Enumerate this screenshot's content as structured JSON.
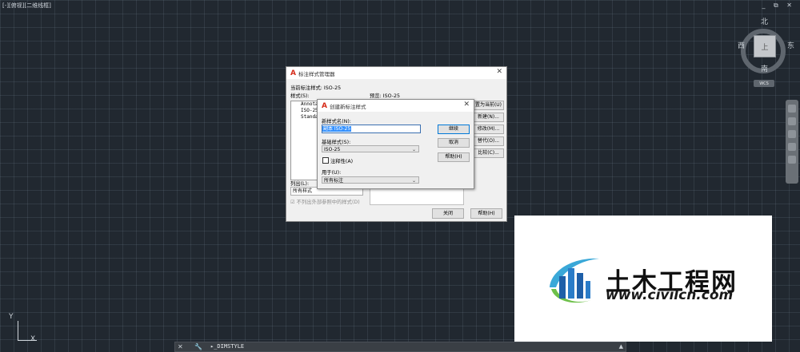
{
  "viewport_label": "[-][俯视][二维线框]",
  "window_controls": "_ ⧉ ✕",
  "viewcube": {
    "north": "北",
    "south": "南",
    "west": "西",
    "east": "东",
    "face": "上",
    "wcs": "WCS"
  },
  "ucs": {
    "x_label": "X",
    "y_label": "Y"
  },
  "command_line": {
    "icons": "✕ 🔧",
    "text": "▸_DIMSTYLE",
    "arrow": "▲"
  },
  "dim_style_manager": {
    "title": "标注样式管理器",
    "current_style": "当前标注样式: ISO-25",
    "styles_label": "样式(S):",
    "styles": [
      "Annotative",
      "ISO-25",
      "Standard"
    ],
    "preview_label": "预览: ISO-25",
    "side_buttons": [
      "置为当前(U)",
      "新建(N)...",
      "修改(M)...",
      "替代(O)...",
      "比较(C)..."
    ],
    "list_label": "列出(L):",
    "list_value": "所有样式",
    "exclude_xref": "不列出外部参照中的样式(D)",
    "close_button": "关闭",
    "help_button": "帮助(H)"
  },
  "new_dim_style": {
    "title": "创建新标注样式",
    "name_label": "新样式名(N):",
    "name_value": "副本 ISO-25",
    "base_label": "基础样式(S):",
    "base_value": "ISO-25",
    "annotative_label": "注释性(A)",
    "use_for_label": "用于(U):",
    "use_for_value": "所有标注",
    "continue_button": "继续",
    "cancel_button": "取消",
    "help_button": "帮助(H)"
  },
  "watermark": {
    "name": "土木工程网",
    "url": "www.civilcn.com"
  },
  "colors": {
    "canvas_bg": "#212830",
    "dialog_bg": "#f0f0f0",
    "autocad_red": "#d62c1a",
    "selection_blue": "#3390ff"
  }
}
